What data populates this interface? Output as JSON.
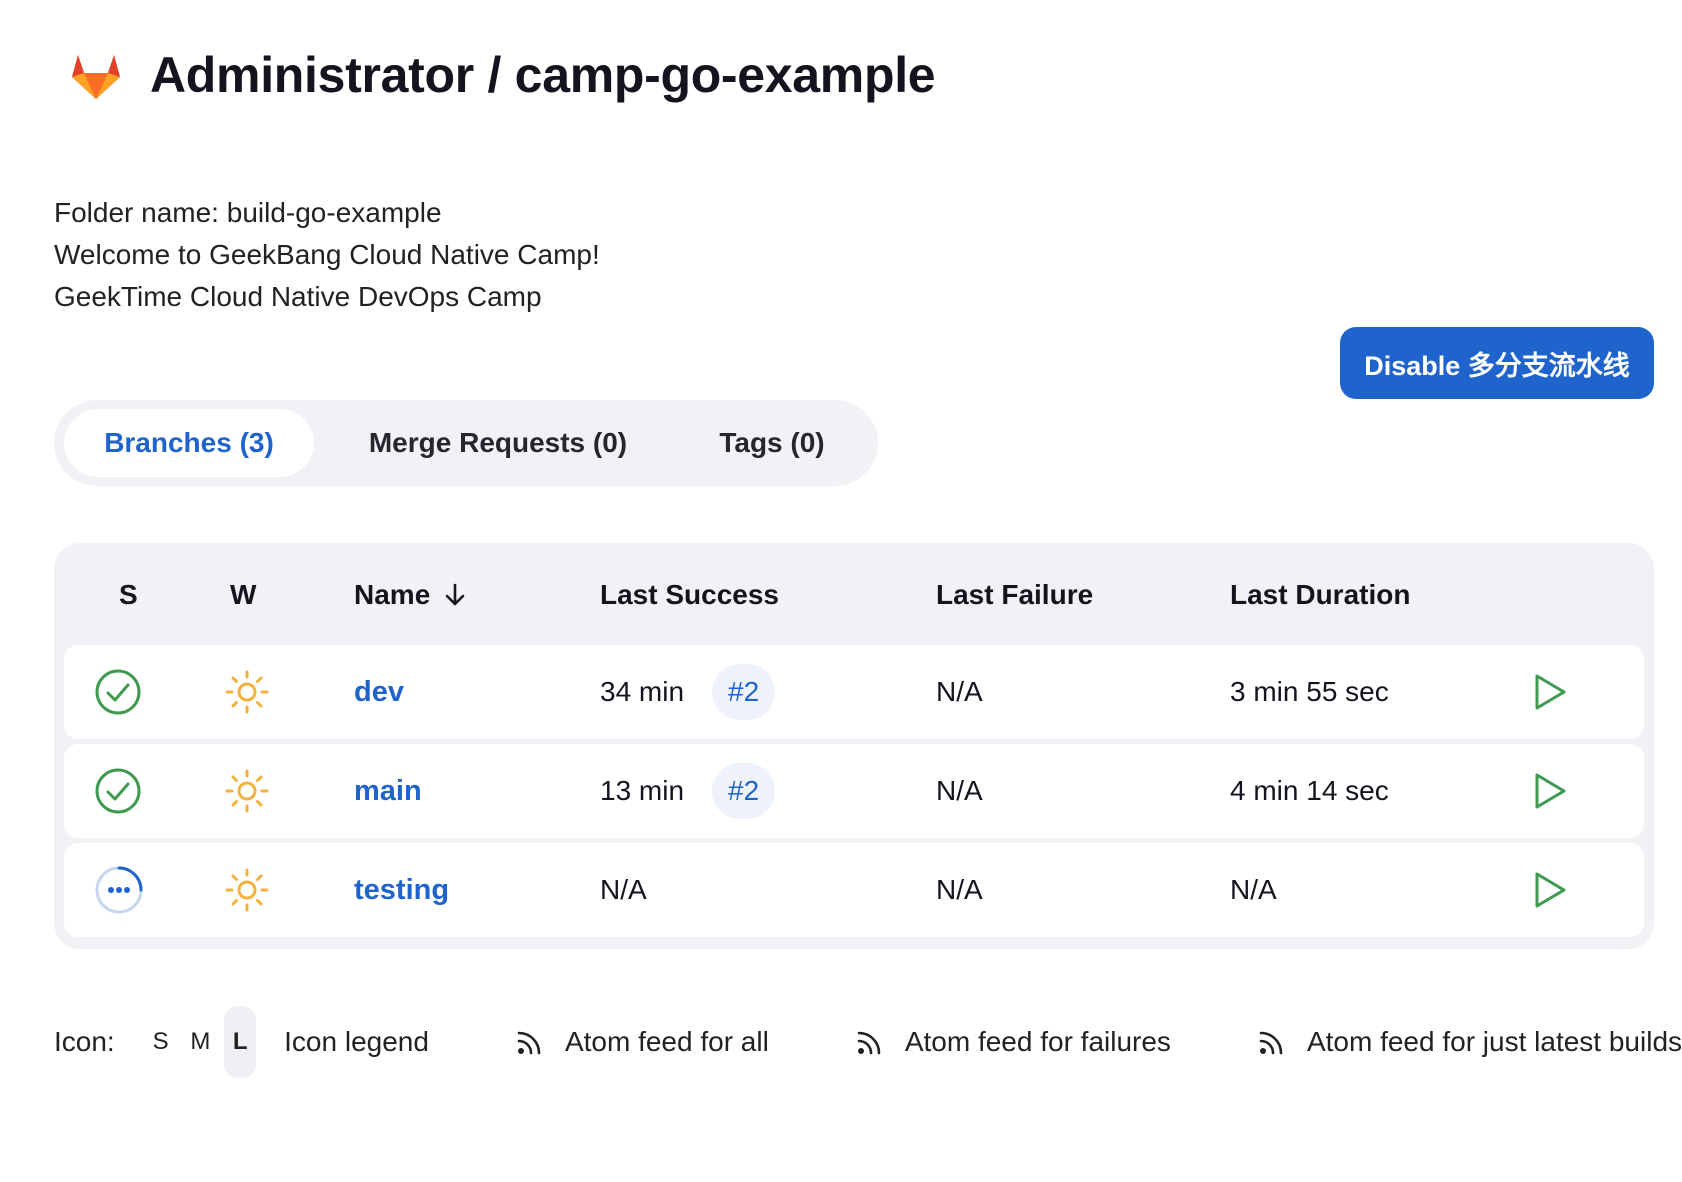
{
  "header": {
    "title": "Administrator / camp-go-example"
  },
  "description": {
    "lines": [
      "Folder name: build-go-example",
      "Welcome to GeekBang Cloud Native Camp!",
      "GeekTime Cloud Native DevOps Camp"
    ]
  },
  "disable_button": "Disable 多分支流水线",
  "tabs": [
    {
      "label": "Branches (3)",
      "active": true
    },
    {
      "label": "Merge Requests (0)",
      "active": false
    },
    {
      "label": "Tags (0)",
      "active": false
    }
  ],
  "table": {
    "headers": {
      "s": "S",
      "w": "W",
      "name": "Name",
      "last_success": "Last Success",
      "last_failure": "Last Failure",
      "last_duration": "Last Duration"
    },
    "rows": [
      {
        "status": "success",
        "weather": "sunny",
        "name": "dev",
        "last_success": "34 min",
        "build": "#2",
        "last_failure": "N/A",
        "last_duration": "3 min 55 sec"
      },
      {
        "status": "success",
        "weather": "sunny",
        "name": "main",
        "last_success": "13 min",
        "build": "#2",
        "last_failure": "N/A",
        "last_duration": "4 min 14 sec"
      },
      {
        "status": "in-progress",
        "weather": "sunny",
        "name": "testing",
        "last_success": "N/A",
        "build": "",
        "last_failure": "N/A",
        "last_duration": "N/A"
      }
    ]
  },
  "footer": {
    "icon_label": "Icon:",
    "sizes": [
      "S",
      "M",
      "L"
    ],
    "active_size": "L",
    "legend": "Icon legend",
    "feeds": [
      "Atom feed for all",
      "Atom feed for failures",
      "Atom feed for just latest builds"
    ]
  },
  "colors": {
    "accent": "#1f63cc",
    "success": "#3d9a4f",
    "weather": "#f4b13d",
    "run": "#3d9a4f"
  }
}
